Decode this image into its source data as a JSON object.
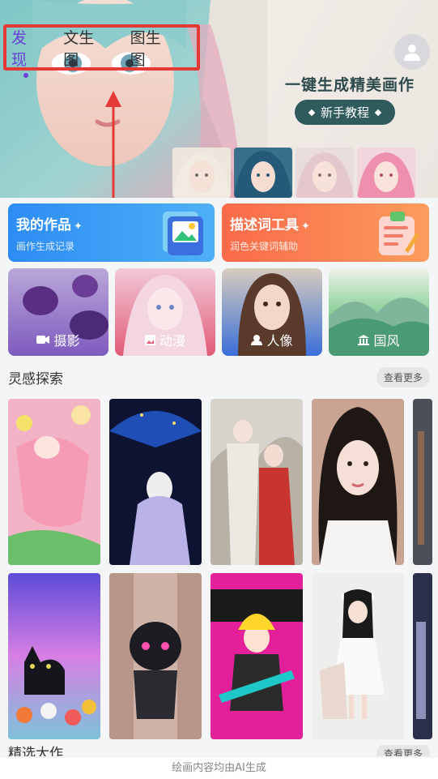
{
  "header": {
    "tabs": [
      {
        "label": "发现",
        "active": true
      },
      {
        "label": "文生图",
        "active": false
      },
      {
        "label": "图生图",
        "active": false
      }
    ],
    "slogan": "一键生成精美画作",
    "tutorial_label": "新手教程",
    "avatar_icon": "user-icon"
  },
  "cards": {
    "works": {
      "title": "我的作品",
      "subtitle": "画作生成记录",
      "icon": "gallery-icon"
    },
    "prompt": {
      "title": "描述词工具",
      "subtitle": "润色关键词辅助",
      "icon": "clipboard-icon"
    }
  },
  "categories": [
    {
      "label": "摄影",
      "icon": "camera-icon"
    },
    {
      "label": "动漫",
      "icon": "image-icon"
    },
    {
      "label": "人像",
      "icon": "portrait-icon"
    },
    {
      "label": "国风",
      "icon": "temple-icon"
    }
  ],
  "inspiration": {
    "title": "灵感探索",
    "more_label": "查看更多"
  },
  "featured": {
    "title": "精选大作",
    "more_label": "查看更多"
  },
  "footer": {
    "note": "绘画内容均由AI生成"
  },
  "colors": {
    "accent": "#6a3fd6",
    "annotation": "#e53935",
    "works_card": "#2c8cf5",
    "prompt_card": "#fb6a4a",
    "tutorial_button": "#2f5b5c"
  }
}
